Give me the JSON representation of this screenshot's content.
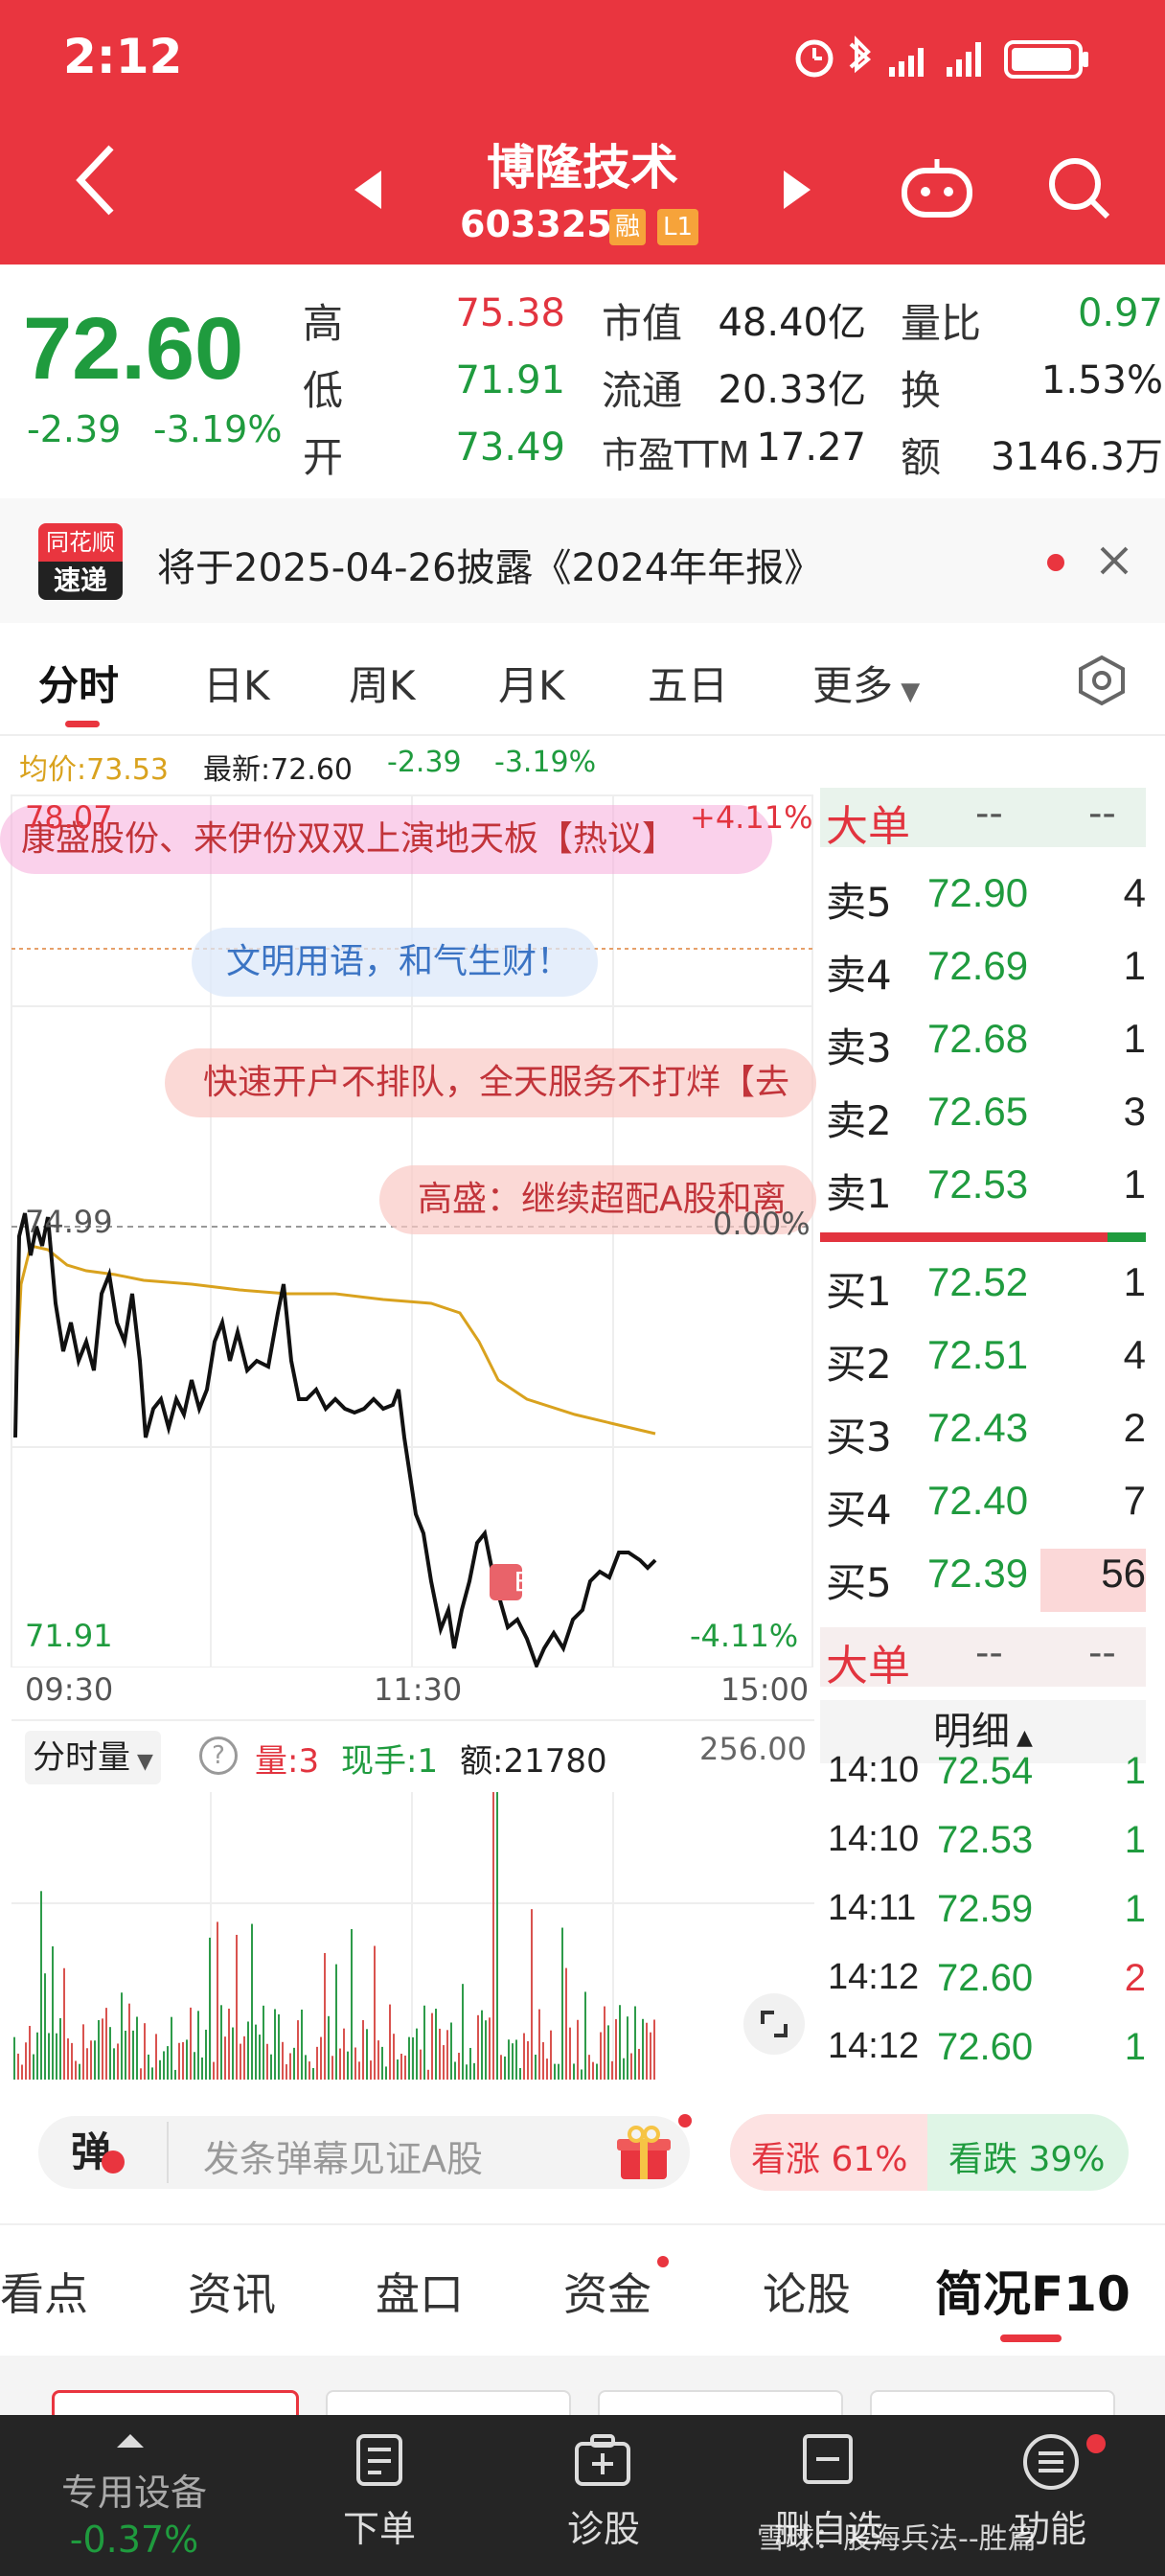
{
  "status": {
    "time": "2:12"
  },
  "header": {
    "name": "博隆技术",
    "code": "603325",
    "tag_rong": "融",
    "tag_l1": "L1"
  },
  "quote": {
    "price": "72.60",
    "change": "-2.39",
    "change_pct": "-3.19%",
    "rows": [
      {
        "l1": "高",
        "v1": "75.38",
        "l2": "市值",
        "v2": "48.40亿",
        "l3": "量比",
        "v3": "0.97"
      },
      {
        "l1": "低",
        "v1": "71.91",
        "l2": "流通",
        "v2": "20.33亿",
        "l3": "换",
        "v3": "1.53%"
      },
      {
        "l1": "开",
        "v1": "73.49",
        "l2": "市盈TTM",
        "v2": "17.27",
        "l3": "额",
        "v3": "3146.3万"
      }
    ]
  },
  "notice": {
    "logo_top": "同花顺",
    "logo_bottom": "速递",
    "text": "将于2025-04-26披露《2024年年报》"
  },
  "chart_tabs": [
    "分时",
    "日K",
    "周K",
    "月K",
    "五日",
    "更多"
  ],
  "legend": {
    "avg": "均价:73.53",
    "latest": "最新:72.60",
    "chg": "-2.39",
    "pct": "-3.19%"
  },
  "chart_labels": {
    "top_price": "78.07",
    "top_pct": "+4.11%",
    "mid_price": "74.99",
    "mid_pct": "0.00%",
    "low_price": "71.91",
    "low_pct": "-4.11%",
    "t1": "09:30",
    "t2": "11:30",
    "t3": "15:00",
    "b_marker": "B"
  },
  "danmaku": [
    "康盛股份、来伊份双双上演地天板【热议】",
    "文明用语，和气生财！",
    "快速开户不排队，全天服务不打烊【去",
    "高盛：继续超配A股和离"
  ],
  "volume_panel": {
    "selector": "分时量",
    "help": "?",
    "vol": "量:3",
    "hand": "现手:1",
    "amount": "额:21780",
    "max": "256.00"
  },
  "orderbook": {
    "title": "大单",
    "dash1": "--",
    "dash2": "--",
    "asks": [
      {
        "label": "卖5",
        "price": "72.90",
        "vol": "4"
      },
      {
        "label": "卖4",
        "price": "72.69",
        "vol": "1"
      },
      {
        "label": "卖3",
        "price": "72.68",
        "vol": "1"
      },
      {
        "label": "卖2",
        "price": "72.65",
        "vol": "3"
      },
      {
        "label": "卖1",
        "price": "72.53",
        "vol": "1"
      }
    ],
    "bids": [
      {
        "label": "买1",
        "price": "72.52",
        "vol": "1"
      },
      {
        "label": "买2",
        "price": "72.51",
        "vol": "4"
      },
      {
        "label": "买3",
        "price": "72.43",
        "vol": "2"
      },
      {
        "label": "买4",
        "price": "72.40",
        "vol": "7"
      },
      {
        "label": "买5",
        "price": "72.39",
        "vol": "56"
      }
    ],
    "title2": "大单",
    "dash3": "--",
    "dash4": "--",
    "detail_label": "明细",
    "ticks": [
      {
        "time": "14:10",
        "price": "72.54",
        "vol": "1"
      },
      {
        "time": "14:10",
        "price": "72.53",
        "vol": "1"
      },
      {
        "time": "14:11",
        "price": "72.59",
        "vol": "1"
      },
      {
        "time": "14:12",
        "price": "72.60",
        "vol": "2"
      },
      {
        "time": "14:12",
        "price": "72.60",
        "vol": "1"
      }
    ]
  },
  "comment": {
    "badge": "弹",
    "placeholder": "发条弹幕见证A股",
    "up": "看涨 61%",
    "down": "看跌 39%",
    "up_pct": 61
  },
  "bottom_tabs": [
    "看点",
    "资讯",
    "盘口",
    "资金",
    "论股",
    "简况F10"
  ],
  "bottom_bar": {
    "device": "专用设备",
    "device_pct": "-0.37%",
    "order": "下单",
    "diagnose": "诊股",
    "delete": "删自选",
    "func": "功能",
    "watermark": "雪球：股海兵法--胜篇"
  },
  "colors": {
    "brand_red": "#e9353f",
    "up": "#e2343f",
    "down": "#1f9b3e",
    "avg_line": "#d9a21e"
  }
}
